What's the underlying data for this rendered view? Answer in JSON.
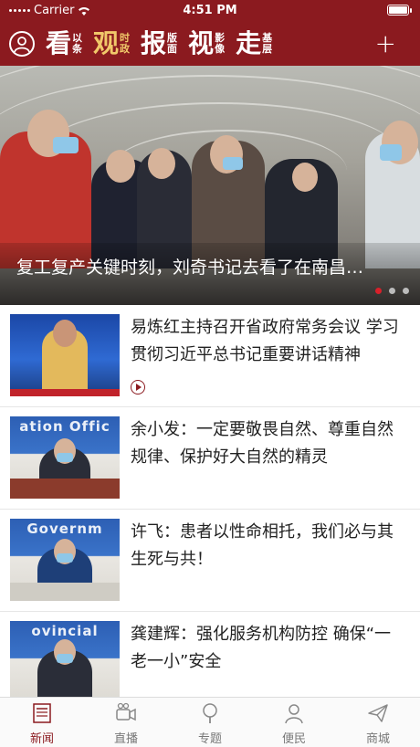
{
  "status_bar": {
    "carrier": "Carrier",
    "time": "4:51 PM"
  },
  "nav": {
    "tabs": [
      {
        "big": "看",
        "small": [
          "以",
          "条"
        ],
        "active": false
      },
      {
        "big": "观",
        "small": [
          "时",
          "政"
        ],
        "active": true
      },
      {
        "big": "报",
        "small": [
          "版",
          "面"
        ],
        "active": false
      },
      {
        "big": "视",
        "small": [
          "影",
          "像"
        ],
        "active": false
      },
      {
        "big": "走",
        "small": [
          "基",
          "层"
        ],
        "active": false
      }
    ],
    "plus_label": "+"
  },
  "banner": {
    "title": "复工复产关键时刻，刘奇书记去看了在南昌…",
    "slide_count": 3,
    "active_slide": 0
  },
  "news": [
    {
      "title": "易炼红主持召开省政府常务会议 学习贯彻习近平总书记重要讲话精神",
      "thumb_text": "",
      "has_video": true
    },
    {
      "title": "余小发：一定要敬畏自然、尊重自然规律、保护好大自然的精灵",
      "thumb_text": "ation Offic",
      "has_video": false
    },
    {
      "title": "许飞：患者以性命相托，我们必与其生死与共！",
      "thumb_text": "Governm",
      "has_video": false
    },
    {
      "title": "龚建辉：强化服务机构防控 确保“一老一小”安全",
      "thumb_text": "ovincial",
      "has_video": false
    }
  ],
  "tab_bar": [
    {
      "label": "新闻",
      "icon": "newspaper-icon",
      "active": true
    },
    {
      "label": "直播",
      "icon": "video-camera-icon",
      "active": false
    },
    {
      "label": "专题",
      "icon": "magnifier-icon",
      "active": false
    },
    {
      "label": "便民",
      "icon": "person-icon",
      "active": false
    },
    {
      "label": "商城",
      "icon": "paper-plane-icon",
      "active": false
    }
  ],
  "colors": {
    "brand": "#8b1a1f",
    "active_tab": "#f1c86a",
    "dot_active": "#d8202a"
  }
}
